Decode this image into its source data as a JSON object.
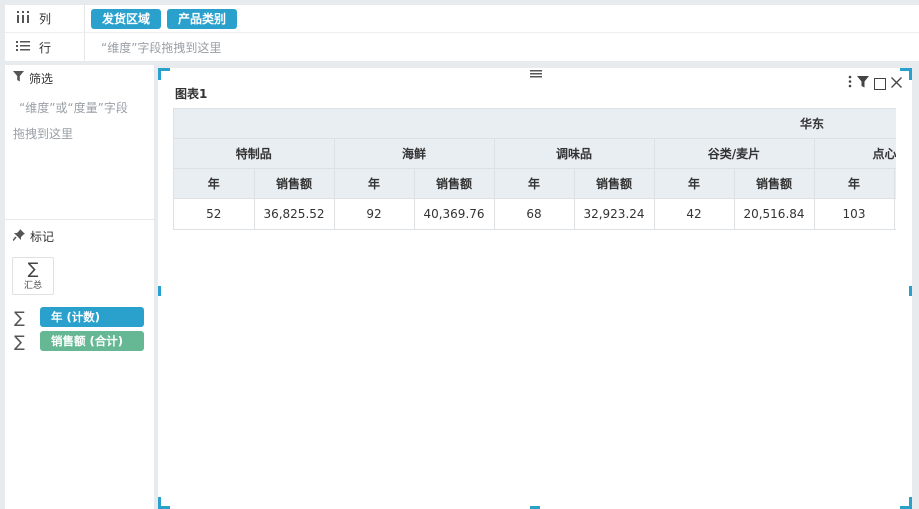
{
  "shelves": {
    "columns": {
      "label": "列",
      "icon": "column-bars-icon",
      "pills": [
        "发货区域",
        "产品类别"
      ]
    },
    "rows": {
      "label": "行",
      "icon": "list-icon",
      "hint": "“维度”字段拖拽到这里"
    }
  },
  "filter": {
    "title": "筛选",
    "icon": "funnel-icon",
    "hint_line1": "“维度”或“度量”字段",
    "hint_line2": "拖拽到这里"
  },
  "marks": {
    "title": "标记",
    "icon": "pin-icon",
    "summary_label": "汇总",
    "summary_icon": "sigma-icon",
    "fields": [
      {
        "label": "年 (计数)",
        "color": "#2aa0cc"
      },
      {
        "label": "销售额 (合计)",
        "color": "#66b894"
      }
    ]
  },
  "chart": {
    "title": "图表1",
    "region": "华东",
    "categories": [
      "特制品",
      "海鲜",
      "调味品",
      "谷类/麦片",
      "点心"
    ],
    "measure_headers": [
      "年",
      "销售额"
    ],
    "values": [
      {
        "year_count": "52",
        "sales": "36,825.52"
      },
      {
        "year_count": "92",
        "sales": "40,369.76"
      },
      {
        "year_count": "68",
        "sales": "32,923.24"
      },
      {
        "year_count": "42",
        "sales": "20,516.84"
      },
      {
        "year_count": "103",
        "sales": ""
      }
    ]
  },
  "colors": {
    "accent": "#2aa0cc",
    "measure_green": "#66b894",
    "header_bg": "#e9eef2"
  }
}
